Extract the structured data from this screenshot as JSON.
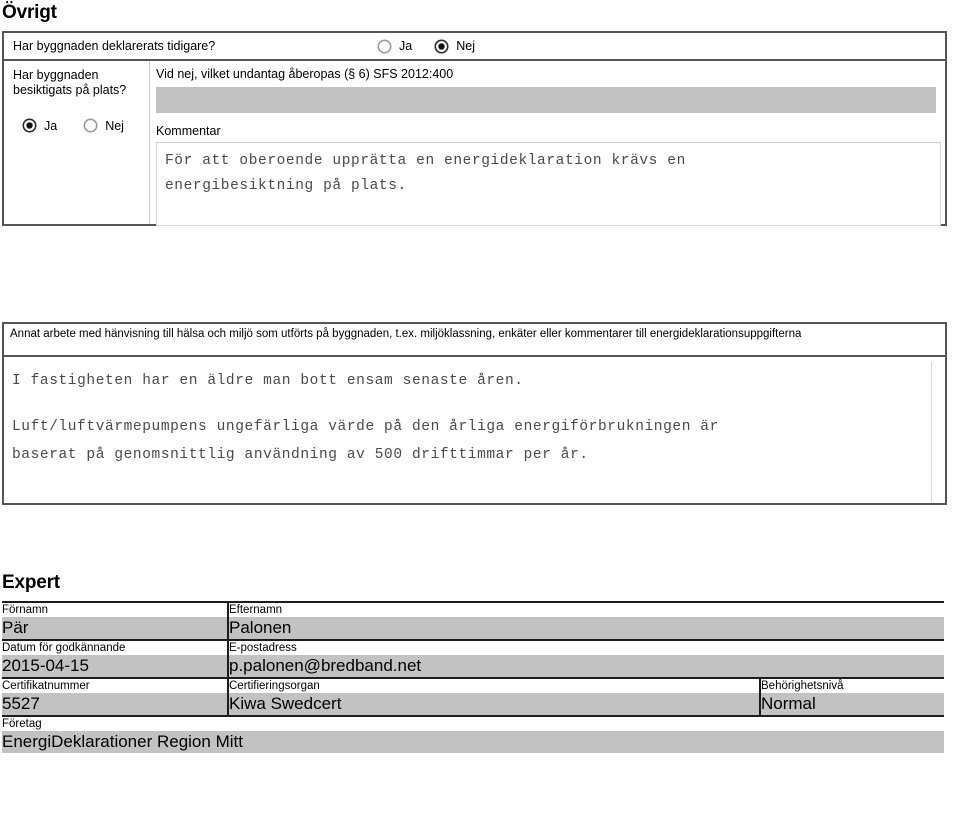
{
  "sections": {
    "ovrigt_heading": "Övrigt",
    "expert_heading": "Expert"
  },
  "ovrigt": {
    "declared_question": "Har byggnaden deklarerats tidigare?",
    "declared_ja": "Ja",
    "declared_nej": "Nej",
    "declared_selected": "Nej",
    "inspected_question": "Har byggnaden besiktigats på plats?",
    "inspected_ja": "Ja",
    "inspected_nej": "Nej",
    "inspected_selected": "Ja",
    "exception_label": "Vid nej, vilket undantag åberopas (§ 6) SFS 2012:400",
    "exception_value": "",
    "kommentar_label": "Kommentar",
    "kommentar_value": "För att oberoende upprätta en energideklaration krävs en\nenergibesiktning på plats."
  },
  "annat": {
    "label": "Annat arbete med hänvisning till hälsa och miljö som utförts på byggnaden, t.ex. miljöklassning, enkäter eller kommentarer till energideklarationsuppgifterna",
    "paragraph_1": "I fastigheten har en äldre man bott ensam senaste åren.",
    "paragraph_2": "Luft/luftvärmepumpens ungefärliga värde på den årliga energiförbrukningen är\nbaserat på genomsnittlig användning av 500 drifttimmar per år."
  },
  "expert": {
    "fornamn_label": "Förnamn",
    "fornamn_value": "Pär",
    "efternamn_label": "Efternamn",
    "efternamn_value": "Palonen",
    "datum_label": "Datum för godkännande",
    "datum_value": "2015-04-15",
    "epost_label": "E-postadress",
    "epost_value": "p.palonen@bredband.net",
    "certifikatnummer_label": "Certifikatnummer",
    "certifikatnummer_value": "5527",
    "certifieringsorgan_label": "Certifieringsorgan",
    "certifieringsorgan_value": "Kiwa Swedcert",
    "behorighetsniva_label": "Behörighetsnivå",
    "behorighetsniva_value": "Normal",
    "foretag_label": "Företag",
    "foretag_value": "EnergiDeklarationer Region Mitt"
  },
  "colors": {
    "field_gray": "#c2c2c2",
    "border_dark": "#555555",
    "rule_black": "#1c1c1c",
    "mono_text": "#4a4a4a"
  }
}
